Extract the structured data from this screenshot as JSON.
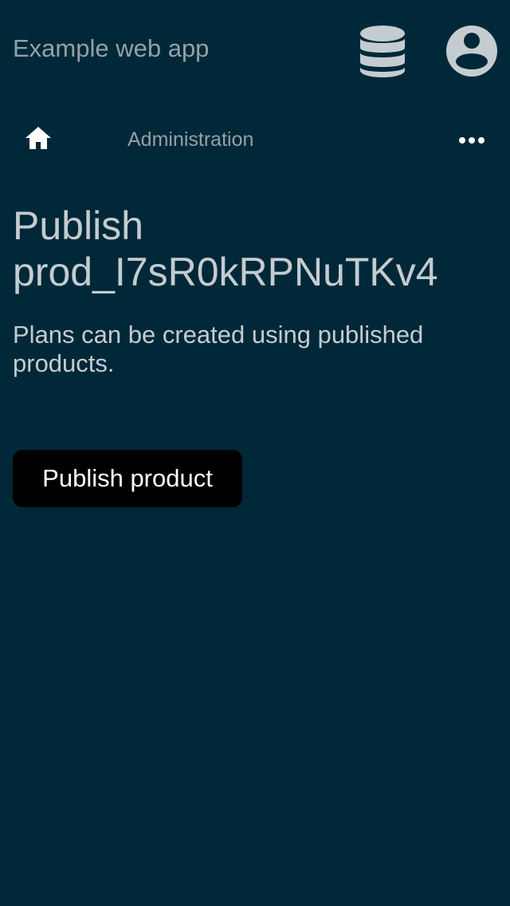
{
  "header": {
    "app_title": "Example web app",
    "database_icon": "database-icon",
    "account_icon": "account-circle-icon"
  },
  "nav": {
    "home_icon": "home-icon",
    "admin_label": "Administration",
    "more_icon": "more-horizontal-icon"
  },
  "main": {
    "title_line1": "Publish",
    "title_line2": "prod_I7sR0kRPNuTKv4",
    "description": "Plans can be created using published products.",
    "publish_button_label": "Publish product"
  },
  "colors": {
    "background": "#002838",
    "muted_text": "#93a1a8",
    "text": "#c4ccd0",
    "button_bg": "#000000",
    "button_text": "#ffffff"
  }
}
